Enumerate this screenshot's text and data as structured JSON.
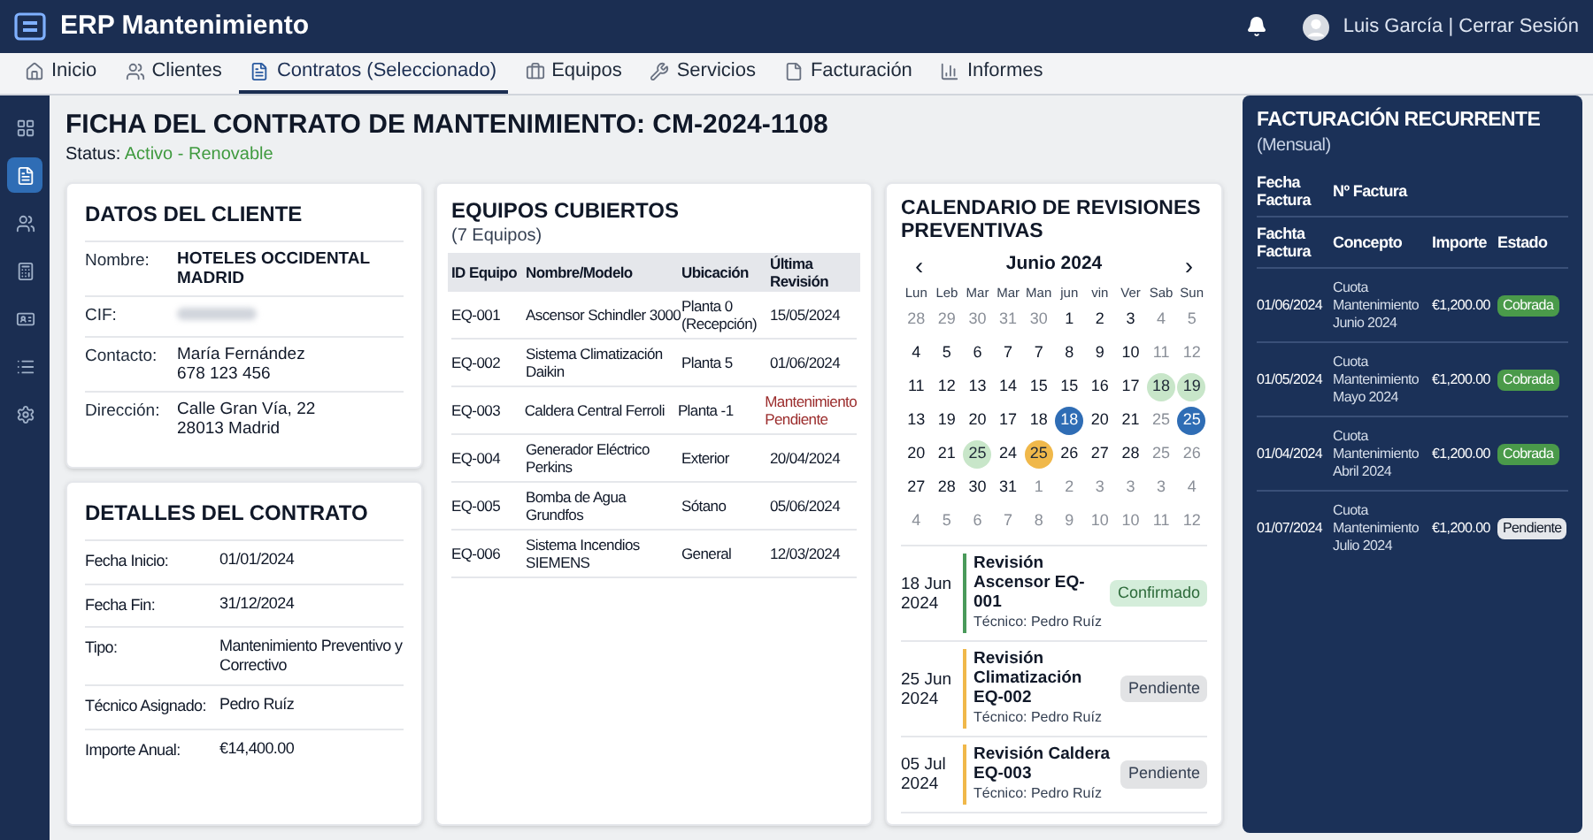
{
  "app": {
    "title": "ERP Mantenimiento",
    "user": "Luis García | Cerrar Sesión"
  },
  "tabs": [
    {
      "label": "Inicio",
      "selected": false
    },
    {
      "label": "Clientes",
      "selected": false
    },
    {
      "label": "Contratos (Seleccionado)",
      "selected": true
    },
    {
      "label": "Equipos",
      "selected": false
    },
    {
      "label": "Servicios",
      "selected": false
    },
    {
      "label": "Facturación",
      "selected": false
    },
    {
      "label": "Informes",
      "selected": false
    }
  ],
  "sidebar": {
    "items": [
      {
        "selected": false
      },
      {
        "selected": true
      },
      {
        "selected": false
      },
      {
        "selected": false
      },
      {
        "selected": false
      },
      {
        "selected": false
      },
      {
        "selected": false
      }
    ]
  },
  "page": {
    "title": "FICHA DEL CONTRATO DE MANTENIMIENTO: CM-2024-1108",
    "status_label": "Status:",
    "status_value": "Activo - Renovable"
  },
  "client": {
    "title": "DATOS DEL CLIENTE",
    "rows": [
      {
        "label": "Nombre:",
        "value": "HOTELES OCCIDENTAL MADRID",
        "kind": "name"
      },
      {
        "label": "CIF:",
        "kind": "redacted"
      },
      {
        "label": "Contacto:",
        "value": "María Fernández\n678 123 456",
        "kind": "text"
      },
      {
        "label": "Dirección:",
        "value": "Calle Gran Vía, 22\n28013 Madrid",
        "kind": "text"
      }
    ]
  },
  "contract": {
    "title": "DETALLES DEL CONTRATO",
    "rows": [
      {
        "label": "Fecha Inicio:",
        "value": "01/01/2024"
      },
      {
        "label": "Fecha Fin:",
        "value": "31/12/2024"
      },
      {
        "label": "Tipo:",
        "value": "Mantenimiento Preventivo y Correctivo"
      },
      {
        "label": "Técnico Asignado:",
        "value": "Pedro Ruíz"
      },
      {
        "label": "Importe Anual:",
        "value": "€14,400.00"
      }
    ]
  },
  "equipment": {
    "title": "EQUIPOS CUBIERTOS",
    "subtitle": "(7 Equipos)",
    "columns": [
      "ID Equipo",
      "Nombre/Modelo",
      "Ubicación",
      "Última Revisión"
    ],
    "rows": [
      {
        "id": "EQ-001",
        "name": "Ascensor Schindler 3000",
        "location": "Planta 0 (Recepción)",
        "last": "15/05/2024",
        "overdue": false
      },
      {
        "id": "EQ-002",
        "name": "Sistema Climatización Daikin",
        "location": "Planta 5",
        "last": "01/06/2024",
        "overdue": false
      },
      {
        "id": "EQ-003",
        "name": "Caldera Central Ferroli",
        "location": "Planta -1",
        "last": "Mantenimiento Pendiente",
        "overdue": true
      },
      {
        "id": "EQ-004",
        "name": "Generador Eléctrico Perkins",
        "location": "Exterior",
        "last": "20/04/2024",
        "overdue": false
      },
      {
        "id": "EQ-005",
        "name": "Bomba de Agua Grundfos",
        "location": "Sótano",
        "last": "05/06/2024",
        "overdue": false
      },
      {
        "id": "EQ-006",
        "name": "Sistema Incendios SIEMENS",
        "location": "General",
        "last": "12/03/2024",
        "overdue": false
      }
    ]
  },
  "calendar": {
    "title": "CALENDARIO DE REVISIONES PREVENTIVAS",
    "prev": "‹",
    "month": "Junio 2024",
    "next": "›",
    "weekdays": [
      "Lun",
      "Leb",
      "Mar",
      "Mar",
      "Man",
      "jun",
      "vin",
      "Ver",
      "Sab",
      "Sun"
    ],
    "weeks": [
      [
        {
          "d": "28",
          "muted": true
        },
        {
          "d": "29",
          "muted": true
        },
        {
          "d": "30",
          "muted": true
        },
        {
          "d": "31",
          "muted": true
        },
        {
          "d": "30",
          "muted": true
        },
        {
          "d": "1",
          "muted": false
        },
        {
          "d": "2",
          "muted": false
        },
        {
          "d": "3",
          "muted": false
        },
        {
          "d": "4",
          "muted": true
        },
        {
          "d": "5",
          "muted": true
        }
      ],
      [
        {
          "d": "4",
          "muted": false
        },
        {
          "d": "5",
          "muted": false
        },
        {
          "d": "6",
          "muted": false
        },
        {
          "d": "7",
          "muted": false
        },
        {
          "d": "7",
          "muted": false
        },
        {
          "d": "8",
          "muted": false
        },
        {
          "d": "9",
          "muted": false
        },
        {
          "d": "10",
          "muted": false
        },
        {
          "d": "11",
          "muted": true
        },
        {
          "d": "12",
          "muted": true
        }
      ],
      [
        {
          "d": "11",
          "muted": false
        },
        {
          "d": "12",
          "muted": false
        },
        {
          "d": "13",
          "muted": false
        },
        {
          "d": "14",
          "muted": false
        },
        {
          "d": "15",
          "muted": false
        },
        {
          "d": "15",
          "muted": false
        },
        {
          "d": "16",
          "muted": false
        },
        {
          "d": "17",
          "muted": false
        },
        {
          "d": "18",
          "muted": false,
          "color": "#c8e6c9"
        },
        {
          "d": "19",
          "muted": false,
          "color": "#c8e6c9"
        }
      ],
      [
        {
          "d": "13",
          "muted": false
        },
        {
          "d": "19",
          "muted": false
        },
        {
          "d": "20",
          "muted": false
        },
        {
          "d": "17",
          "muted": false
        },
        {
          "d": "18",
          "muted": false
        },
        {
          "d": "18",
          "muted": false,
          "color": "#2f6db5"
        },
        {
          "d": "20",
          "muted": false
        },
        {
          "d": "21",
          "muted": false
        },
        {
          "d": "25",
          "muted": true
        },
        {
          "d": "25",
          "muted": false,
          "color": "#2f6db5"
        }
      ],
      [
        {
          "d": "20",
          "muted": false
        },
        {
          "d": "21",
          "muted": false
        },
        {
          "d": "25",
          "muted": false,
          "color": "#c8e6c9"
        },
        {
          "d": "24",
          "muted": false
        },
        {
          "d": "25",
          "muted": false,
          "color": "#f0b84a"
        },
        {
          "d": "26",
          "muted": false
        },
        {
          "d": "27",
          "muted": false
        },
        {
          "d": "28",
          "muted": false
        },
        {
          "d": "25",
          "muted": true
        },
        {
          "d": "26",
          "muted": true
        }
      ],
      [
        {
          "d": "27",
          "muted": false
        },
        {
          "d": "28",
          "muted": false
        },
        {
          "d": "30",
          "muted": false
        },
        {
          "d": "31",
          "muted": false
        },
        {
          "d": "1",
          "muted": true
        },
        {
          "d": "2",
          "muted": true
        },
        {
          "d": "3",
          "muted": true
        },
        {
          "d": "3",
          "muted": true
        },
        {
          "d": "3",
          "muted": true
        },
        {
          "d": "4",
          "muted": true
        }
      ],
      [
        {
          "d": "4",
          "muted": true
        },
        {
          "d": "5",
          "muted": true
        },
        {
          "d": "6",
          "muted": true
        },
        {
          "d": "7",
          "muted": true
        },
        {
          "d": "8",
          "muted": true
        },
        {
          "d": "9",
          "muted": true
        },
        {
          "d": "10",
          "muted": true
        },
        {
          "d": "10",
          "muted": true
        },
        {
          "d": "11",
          "muted": true
        },
        {
          "d": "12",
          "muted": true
        }
      ]
    ],
    "events": [
      {
        "date": "18 Jun 2024",
        "title": "Revisión Ascensor EQ-001",
        "tech": "Técnico: Pedro Ruíz",
        "status": "Confirmado",
        "kind": "confirmed"
      },
      {
        "date": "25 Jun 2024",
        "title": "Revisión Climatización EQ-002",
        "tech": "Técnico: Pedro Ruíz",
        "status": "Pendiente",
        "kind": "pending"
      },
      {
        "date": "05 Jul 2024",
        "title": "Revisión Caldera EQ-003",
        "tech": "Técnico: Pedro Ruíz",
        "status": "Pendiente",
        "kind": "pending"
      }
    ]
  },
  "billing": {
    "title": "FACTURACIÓN RECURRENTE",
    "subtitle": "(Mensual)",
    "header1": [
      "Fecha Factura",
      "Nº Factura"
    ],
    "header2": [
      "Fachta Factura",
      "Concepto",
      "Importe",
      "Estado"
    ],
    "rows": [
      {
        "date": "01/06/2024",
        "concept": "Cuota Mantenimiento Junio 2024",
        "amount": "€1,200.00",
        "status": "Cobrada",
        "kind": "paid"
      },
      {
        "date": "01/05/2024",
        "concept": "Cuota Mantenimiento Mayo 2024",
        "amount": "€1,200.00",
        "status": "Cobrada",
        "kind": "paid"
      },
      {
        "date": "01/04/2024",
        "concept": "Cuota Mantenimiento Abril 2024",
        "amount": "€1,200.00",
        "status": "Cobrada",
        "kind": "paid"
      },
      {
        "date": "01/07/2024",
        "concept": "Cuota Mantenimiento Julio 2024",
        "amount": "€1,200.00",
        "status": "Pendiente",
        "kind": "pending"
      }
    ]
  }
}
